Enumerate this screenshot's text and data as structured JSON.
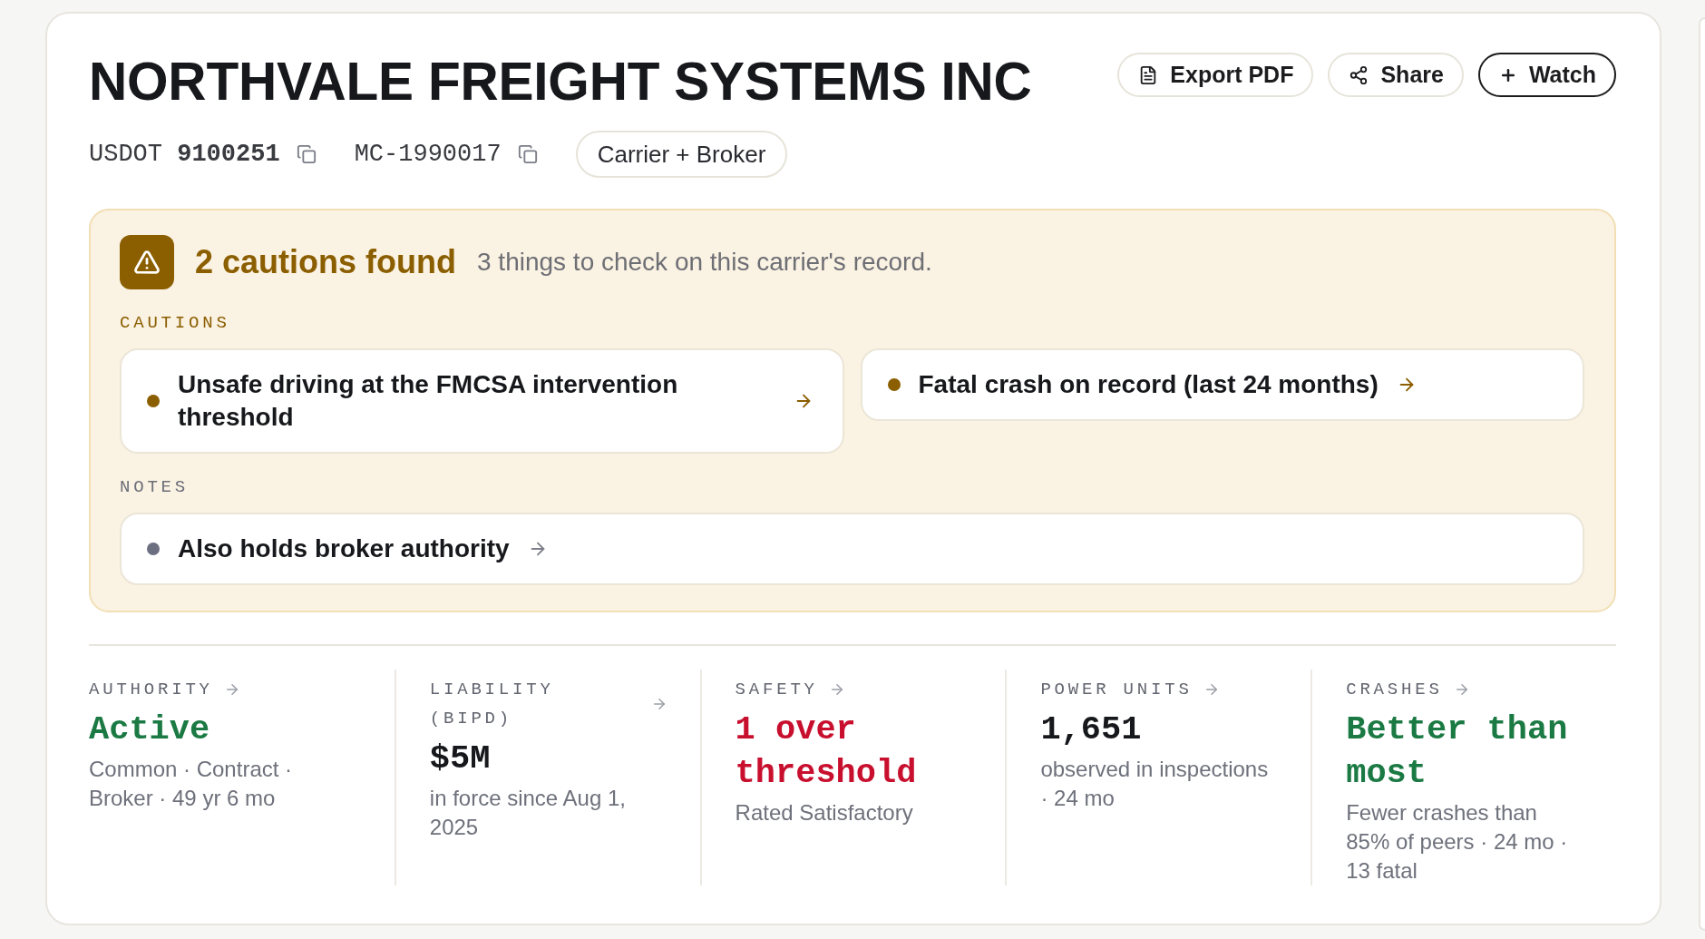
{
  "header": {
    "title": "NORTHVALE FREIGHT SYSTEMS INC",
    "actions": [
      {
        "kind": "export",
        "label": "Export PDF",
        "emphasized": false
      },
      {
        "kind": "share",
        "label": "Share",
        "emphasized": false
      },
      {
        "kind": "watch",
        "label": "Watch",
        "emphasized": true
      }
    ]
  },
  "identifiers": [
    {
      "text": "USDOT **9100251**"
    },
    {
      "text": "MC-1990017"
    }
  ],
  "entity_type": "Carrier + Broker",
  "alerts": {
    "title": "2 cautions found",
    "summary": "3 things to check on this carrier's record.",
    "groups": [
      {
        "kind": "caution",
        "heading": "CAUTIONS",
        "items": [
          "Unsafe driving at the FMCSA intervention threshold",
          "Fatal crash on record (last 24 months)"
        ]
      },
      {
        "kind": "note",
        "heading": "NOTES",
        "items": [
          "Also holds broker authority"
        ]
      }
    ]
  },
  "stats": [
    {
      "label": "AUTHORITY",
      "value": "Active",
      "kind": "positive",
      "detail": "Common · Contract · Broker · 49 yr 6 mo"
    },
    {
      "label": "LIABILITY (BIPD)",
      "value": "$5M",
      "kind": "neutral",
      "detail": "in force since Aug 1, 2025"
    },
    {
      "label": "SAFETY",
      "value": "1 over threshold",
      "kind": "negative",
      "detail": "Rated Satisfactory"
    },
    {
      "label": "POWER UNITS",
      "value": "1,651",
      "kind": "neutral",
      "detail": "observed in inspections · 24 mo"
    },
    {
      "label": "CRASHES",
      "value": "Better than most",
      "kind": "positive",
      "detail": "Fewer crashes than 85% of peers · 24 mo · 13 fatal"
    }
  ]
}
